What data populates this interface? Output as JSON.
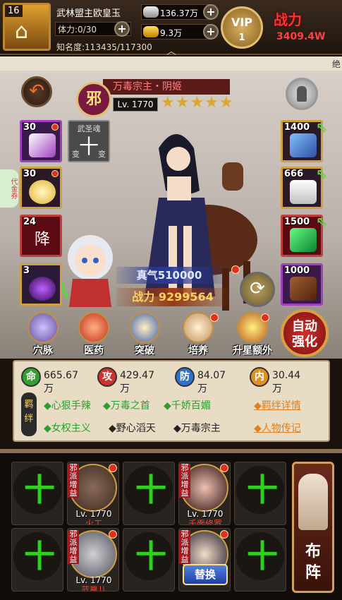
{
  "player": {
    "level": "16",
    "name": "武林盟主欧皇玉",
    "stamina_label": "体力:",
    "stamina_value": "0/30",
    "fame_label": "知名度:",
    "fame_value": "113435/117300",
    "silver": "136.37万",
    "gold": "9.3万",
    "vip_text": "VIP",
    "vip_level": "1",
    "power_label": "战力",
    "power_value": "3409.4W"
  },
  "strip_text": "绝",
  "hero": {
    "sect_badge": "邪",
    "title": "万毒宗主・阴姬",
    "level": "Lv. 1770",
    "stars": "★★★★★",
    "true_qi_label": "真气",
    "true_qi": "510000",
    "combat_label": "战力",
    "combat": "9299564"
  },
  "soul_slot": {
    "title": "武圣魂",
    "glyph": "十",
    "left_char": "变",
    "right_char": "变"
  },
  "equipment_left": [
    {
      "num": "30",
      "color": "#a040c0"
    },
    {
      "num": "30",
      "color": "#e0b030"
    },
    {
      "num": "24",
      "color": "#c04040",
      "glyph": "降"
    },
    {
      "num": "3",
      "color": "#6030a0"
    }
  ],
  "equipment_right": [
    {
      "num": "1400",
      "color": "#4060c0"
    },
    {
      "num": "666",
      "color": "#e0e0e0"
    },
    {
      "num": "1500",
      "color": "#30a040"
    },
    {
      "num": "1000",
      "color": "#8a4020"
    }
  ],
  "side_tag": "代金券",
  "menu": [
    {
      "label": "穴脉"
    },
    {
      "label": "医药"
    },
    {
      "label": "突破"
    },
    {
      "label": "培养"
    },
    {
      "label": "升星额外"
    }
  ],
  "auto_button": {
    "line1": "自动",
    "line2": "强化"
  },
  "stats": [
    {
      "badge": "命",
      "value": "665.67万",
      "bg": "#30a030"
    },
    {
      "badge": "攻",
      "value": "429.47万",
      "bg": "#d03030"
    },
    {
      "badge": "防",
      "value": "84.07万",
      "bg": "#3070d0"
    },
    {
      "badge": "内",
      "value": "30.44万",
      "bg": "#e09020"
    }
  ],
  "bonds": {
    "label": "羁绊",
    "row1": [
      "◆心狠手辣",
      "◆万毒之首",
      "◆千娇百媚"
    ],
    "row2_green": "◆女权主义",
    "row2_dark": [
      "◆野心滔天",
      "◆万毒宗主"
    ],
    "link1": "◆羁绊详情",
    "link2": "◆人物传记"
  },
  "team": [
    {
      "type": "empty"
    },
    {
      "type": "hero",
      "tag": "邪派增益",
      "level": "Lv. 1770",
      "name": "火工"
    },
    {
      "type": "empty"
    },
    {
      "type": "hero",
      "tag": "邪派增益",
      "level": "Lv. 1770",
      "name": "千面修罗"
    },
    {
      "type": "empty"
    },
    {
      "type": "empty"
    },
    {
      "type": "hero",
      "tag": "邪派增益",
      "level": "Lv. 1770",
      "name": "蓝凰儿"
    },
    {
      "type": "empty"
    },
    {
      "type": "hero-replace",
      "tag": "邪派增益",
      "button": "替换"
    },
    {
      "type": "empty"
    }
  ],
  "empty_slot_glyph": "十",
  "formation": {
    "line1": "布",
    "line2": "阵"
  }
}
